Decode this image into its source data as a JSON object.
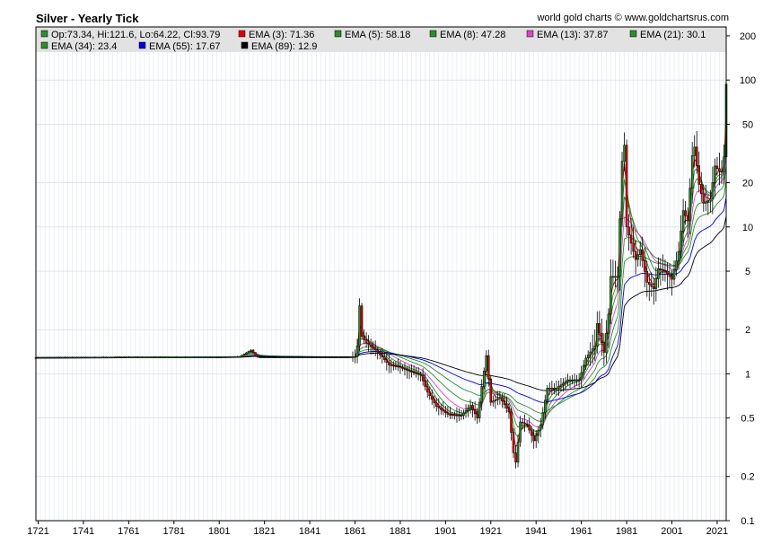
{
  "chart_title": "Silver - Yearly Tick",
  "credit": "world gold charts © www.goldchartsrus.com",
  "legend": [
    {
      "text": "Op:73.34, Hi:121.6, Lo:64.22, Cl:93.79",
      "color": "#2e8b2e"
    },
    {
      "text": "EMA (3): 71.36",
      "color": "#dd0000"
    },
    {
      "text": "EMA (5): 58.18",
      "color": "#2e8b2e"
    },
    {
      "text": "EMA (8): 47.28",
      "color": "#2e8b2e"
    },
    {
      "text": "EMA (13): 37.87",
      "color": "#dd44cc"
    },
    {
      "text": "EMA (21): 30.1",
      "color": "#2e8b2e"
    },
    {
      "text": "EMA (34): 23.4",
      "color": "#2e8b2e"
    },
    {
      "text": "EMA (55): 17.67",
      "color": "#0000dd"
    },
    {
      "text": "EMA (89): 12.9",
      "color": "#000000"
    }
  ],
  "chart_data": {
    "type": "candlestick",
    "scale": "log",
    "x_ticks": [
      "1721",
      "1741",
      "1761",
      "1781",
      "1801",
      "1821",
      "1841",
      "1861",
      "1881",
      "1901",
      "1921",
      "1941",
      "1961",
      "1981",
      "2001",
      "2021"
    ],
    "y_ticks": [
      "0.1",
      "0.2",
      "0.5",
      "1",
      "2",
      "5",
      "10",
      "20",
      "50",
      "100",
      "200"
    ],
    "xlim": [
      1720,
      2025
    ],
    "ylim": [
      0.1,
      230
    ],
    "series_keypoints": [
      [
        1720,
        1.29
      ],
      [
        1760,
        1.3
      ],
      [
        1800,
        1.3
      ],
      [
        1810,
        1.31
      ],
      [
        1815,
        1.45
      ],
      [
        1818,
        1.3
      ],
      [
        1850,
        1.3
      ],
      [
        1858,
        1.3
      ],
      [
        1861,
        1.31
      ],
      [
        1862,
        1.55
      ],
      [
        1863,
        2.9
      ],
      [
        1864,
        1.8
      ],
      [
        1866,
        1.62
      ],
      [
        1870,
        1.45
      ],
      [
        1873,
        1.3
      ],
      [
        1876,
        1.15
      ],
      [
        1880,
        1.12
      ],
      [
        1885,
        1.04
      ],
      [
        1890,
        0.98
      ],
      [
        1893,
        0.75
      ],
      [
        1897,
        0.6
      ],
      [
        1902,
        0.53
      ],
      [
        1908,
        0.52
      ],
      [
        1912,
        0.61
      ],
      [
        1915,
        0.5
      ],
      [
        1917,
        0.82
      ],
      [
        1919,
        1.33
      ],
      [
        1921,
        0.64
      ],
      [
        1925,
        0.69
      ],
      [
        1929,
        0.55
      ],
      [
        1931,
        0.29
      ],
      [
        1932,
        0.25
      ],
      [
        1934,
        0.47
      ],
      [
        1937,
        0.45
      ],
      [
        1940,
        0.35
      ],
      [
        1943,
        0.45
      ],
      [
        1946,
        0.8
      ],
      [
        1950,
        0.8
      ],
      [
        1955,
        0.91
      ],
      [
        1960,
        0.91
      ],
      [
        1963,
        1.28
      ],
      [
        1967,
        1.55
      ],
      [
        1968,
        2.2
      ],
      [
        1971,
        1.4
      ],
      [
        1973,
        2.55
      ],
      [
        1974,
        4.6
      ],
      [
        1977,
        4.6
      ],
      [
        1979,
        28.0
      ],
      [
        1980,
        36.0
      ],
      [
        1981,
        10.0
      ],
      [
        1985,
        6.0
      ],
      [
        1987,
        7.0
      ],
      [
        1990,
        4.2
      ],
      [
        1993,
        3.8
      ],
      [
        1995,
        5.2
      ],
      [
        1998,
        5.0
      ],
      [
        2001,
        4.4
      ],
      [
        2004,
        6.8
      ],
      [
        2006,
        12.9
      ],
      [
        2008,
        11.0
      ],
      [
        2010,
        30.6
      ],
      [
        2011,
        35.0
      ],
      [
        2013,
        19.5
      ],
      [
        2015,
        14.5
      ],
      [
        2018,
        15.5
      ],
      [
        2020,
        26.0
      ],
      [
        2022,
        24.0
      ],
      [
        2023,
        23.8
      ],
      [
        2024,
        30.0
      ],
      [
        2025,
        93.8
      ]
    ],
    "ema_periods": [
      3,
      5,
      8,
      13,
      21,
      34,
      55,
      89
    ]
  }
}
